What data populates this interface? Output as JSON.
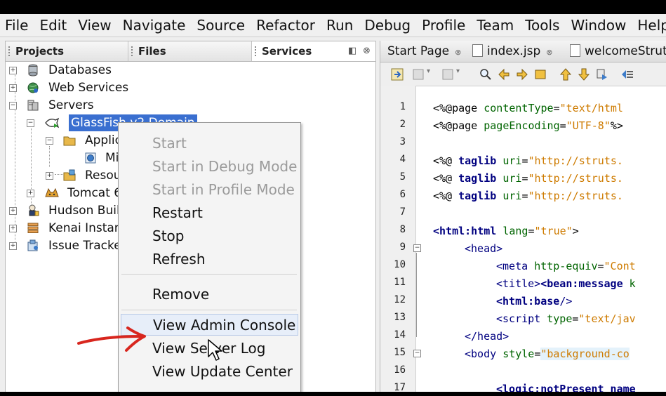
{
  "menu": [
    "File",
    "Edit",
    "View",
    "Navigate",
    "Source",
    "Refactor",
    "Run",
    "Debug",
    "Profile",
    "Team",
    "Tools",
    "Window",
    "Help"
  ],
  "panel_tabs": {
    "projects": "Projects",
    "files": "Files",
    "services": "Services"
  },
  "tree": {
    "databases": "Databases",
    "web_services": "Web Services",
    "servers": "Servers",
    "glassfish": "GlassFish v2 Domain",
    "applications": "Applic",
    "mi": "Mi",
    "resources": "Resou",
    "tomcat": "Tomcat 6",
    "hudson": "Hudson Build",
    "kenai": "Kenai Instan",
    "issue": "Issue Tracke"
  },
  "context_menu": {
    "start": "Start",
    "start_debug": "Start in Debug Mode",
    "start_profile": "Start in Profile Mode",
    "restart": "Restart",
    "stop": "Stop",
    "refresh": "Refresh",
    "remove": "Remove",
    "view_admin": "View Admin Console",
    "view_log": "View Server Log",
    "view_update": "View Update Center"
  },
  "editor_tabs": {
    "start_page": "Start Page",
    "index": "index.jsp",
    "welcome": "welcomeStrut"
  },
  "line_numbers": [
    "1",
    "2",
    "3",
    "4",
    "5",
    "6",
    "7",
    "8",
    "9",
    "10",
    "11",
    "12",
    "13",
    "14",
    "15",
    "16",
    "17"
  ],
  "code": {
    "l1a": "<%@page ",
    "l1b": "contentType",
    "l1c": "=",
    "l1d": "\"text/html",
    "l2a": "<%@page ",
    "l2b": "pageEncoding",
    "l2c": "=",
    "l2d": "\"UTF-8\"",
    "l2e": "%>",
    "l4a": "<%@ ",
    "l4b": "taglib ",
    "l4c": "uri",
    "l4d": "=",
    "l4e": "\"http://struts.",
    "l5a": "<%@ ",
    "l5b": "taglib ",
    "l5c": "uri",
    "l5d": "=",
    "l5e": "\"http://struts.",
    "l6a": "<%@ ",
    "l6b": "taglib ",
    "l6c": "uri",
    "l6d": "=",
    "l6e": "\"http://struts.",
    "l8a": "<html:html ",
    "l8b": "lang",
    "l8c": "=",
    "l8d": "\"true\"",
    "l8e": ">",
    "l9": "<head>",
    "l10a": "<meta ",
    "l10b": "http-equiv",
    "l10c": "=",
    "l10d": "\"Cont",
    "l11a": "<title>",
    "l11b": "<bean:message ",
    "l11c": "k",
    "l12a": "<html:base",
    "l12b": "/>",
    "l13a": "<script ",
    "l13b": "type",
    "l13c": "=",
    "l13d": "\"text/jav",
    "l14": "</head>",
    "l15a": "<body ",
    "l15b": "style",
    "l15c": "=",
    "l15d": "\"background-co",
    "l17": "<logic:notPresent name"
  }
}
